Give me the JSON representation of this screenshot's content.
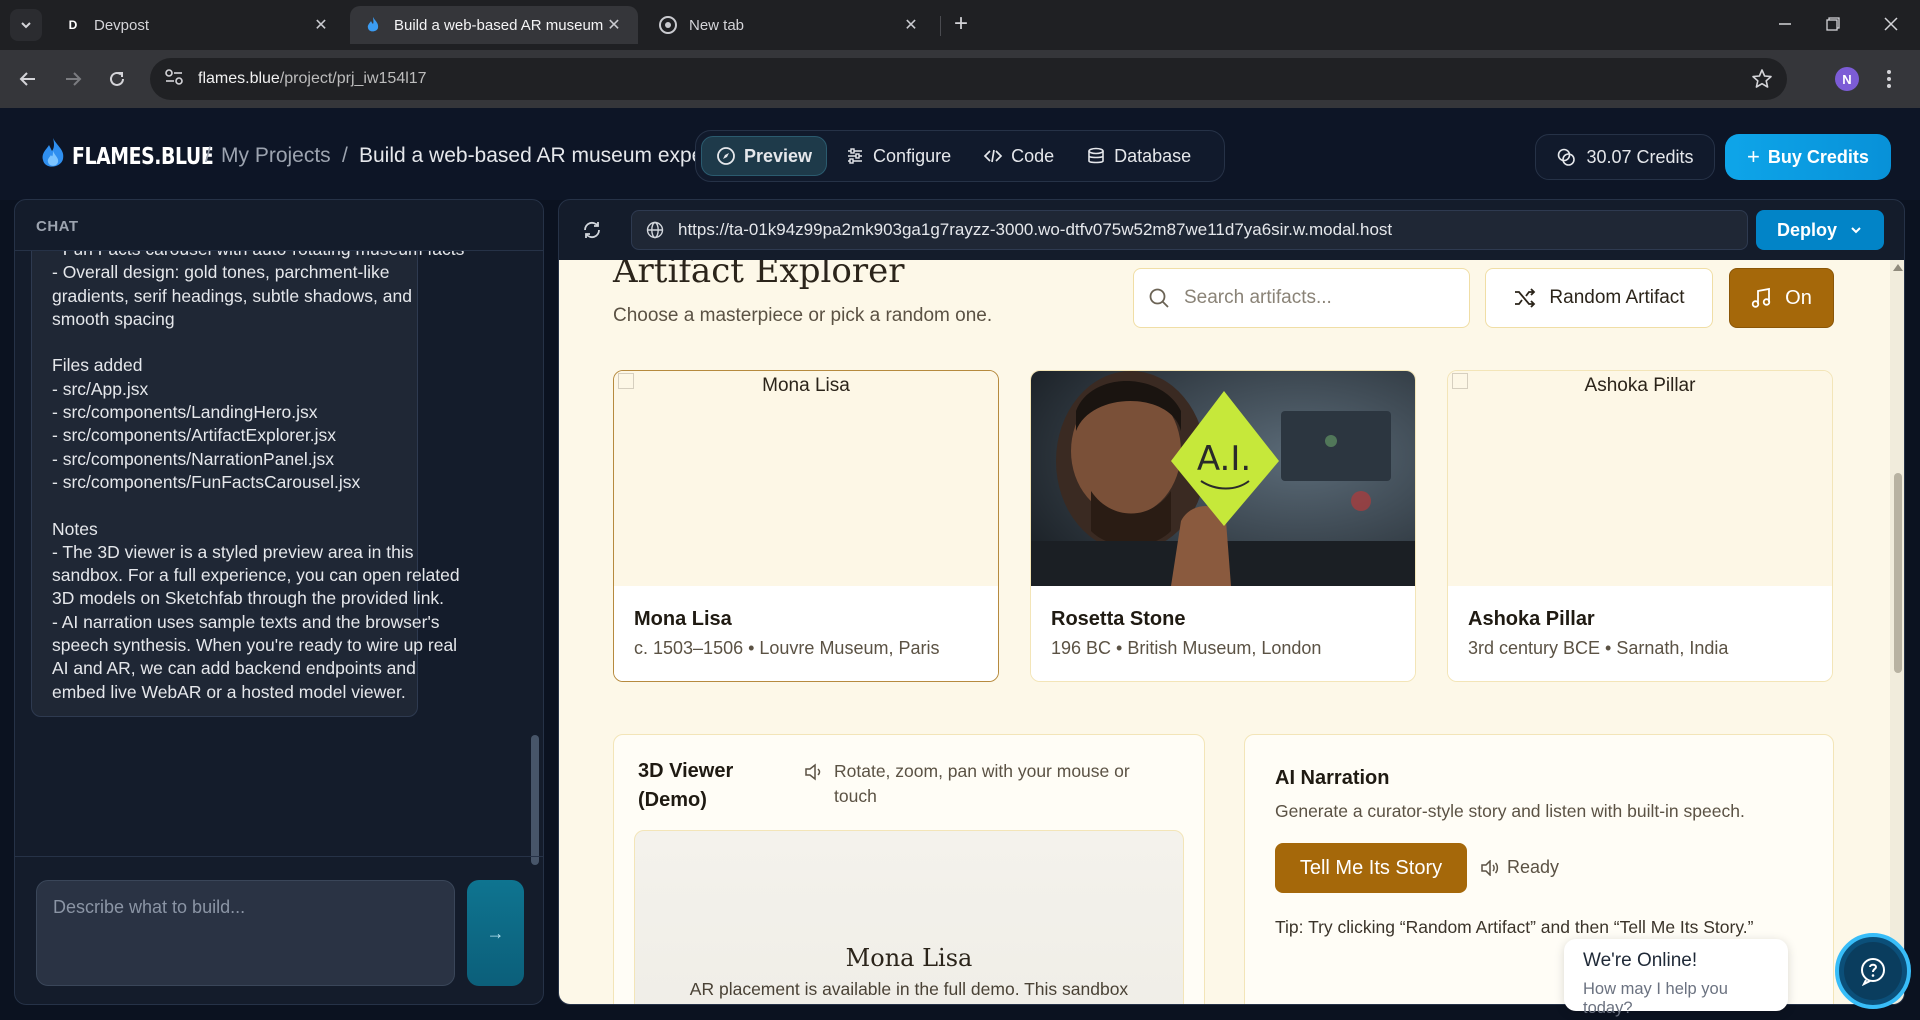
{
  "browser": {
    "tabs": [
      {
        "title": "Devpost",
        "favicon": "D"
      },
      {
        "title": "Build a web-based AR museum",
        "favicon": "flame-icon"
      },
      {
        "title": "New tab",
        "favicon": "chrome-icon"
      }
    ],
    "url_host": "flames.blue",
    "url_path": "/project/prj_iw154l17",
    "profile_initial": "N"
  },
  "header": {
    "brand": "FLAMES.BLUE",
    "breadcrumb_sep": "/",
    "breadcrumb_projects": "My Projects",
    "breadcrumb_current": "Build a web-based AR museum experience",
    "tabs": [
      "Preview",
      "Configure",
      "Code",
      "Database"
    ],
    "credits": "30.07 Credits",
    "buy_label": "Buy Credits"
  },
  "chat": {
    "label": "CHAT",
    "lines": [
      "- Fun Facts carousel with auto-rotating museum facts",
      "- Overall design: gold tones, parchment-like",
      "gradients, serif headings, subtle shadows, and",
      "smooth spacing",
      "",
      "Files added",
      "- src/App.jsx",
      "- src/components/LandingHero.jsx",
      "- src/components/ArtifactExplorer.jsx",
      "- src/components/NarrationPanel.jsx",
      "- src/components/FunFactsCarousel.jsx",
      "",
      "Notes",
      "- The 3D viewer is a styled preview area in this",
      "sandbox. For a full experience, you can open related",
      "3D models on Sketchfab through the provided link.",
      "- AI narration uses sample texts and the browser's",
      "speech synthesis. When you're ready to wire up real",
      "AI and AR, we can add backend endpoints and",
      "embed live WebAR or a hosted model viewer."
    ],
    "composer_placeholder": "Describe what to build...",
    "send_label": "→"
  },
  "preview": {
    "url": "https://ta-01k94z99pa2mk903ga1g7rayzz-3000.wo-dtfv075w52m87we11d7ya6sir.w.modal.host",
    "deploy_label": "Deploy"
  },
  "site": {
    "heading": "Artifact Explorer",
    "subheading": "Choose a masterpiece or pick a random one.",
    "search_placeholder": "Search artifacts...",
    "random_label": "Random Artifact",
    "music_label": "On",
    "artifacts": [
      {
        "alt": "Mona Lisa",
        "name": "Mona Lisa",
        "meta": "c. 1503–1506 • Louvre Museum, Paris"
      },
      {
        "alt": "",
        "name": "Rosetta Stone",
        "meta": "196 BC • British Museum, London",
        "image_text": "A.I."
      },
      {
        "alt": "Ashoka Pillar",
        "name": "Ashoka Pillar",
        "meta": "3rd century BCE • Sarnath, India"
      }
    ],
    "viewer": {
      "title": "3D Viewer (Demo)",
      "hint": "Rotate, zoom, pan with your mouse or touch",
      "stage_name": "Mona Lisa",
      "stage_note": "AR placement is available in the full demo. This sandbox"
    },
    "narration": {
      "title": "AI Narration",
      "desc": "Generate a curator-style story and listen with built-in speech.",
      "button": "Tell Me Its Story",
      "status": "Ready",
      "tip": "Tip: Try clicking “Random Artifact” and then “Tell Me Its Story.”"
    }
  },
  "widget": {
    "title": "We're Online!",
    "subtitle": "How may I help you today?"
  }
}
